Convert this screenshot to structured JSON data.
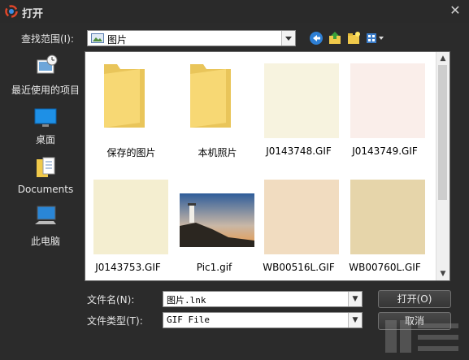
{
  "window": {
    "title": "打开"
  },
  "lookin": {
    "label": "查找范围(I):",
    "value": "图片"
  },
  "places": [
    {
      "label": "最近使用的项目",
      "icon": "recent-items-icon"
    },
    {
      "label": "桌面",
      "icon": "desktop-icon"
    },
    {
      "label": "Documents",
      "icon": "documents-icon"
    },
    {
      "label": "此电脑",
      "icon": "computer-icon"
    }
  ],
  "files": [
    {
      "name": "保存的图片",
      "kind": "folder"
    },
    {
      "name": "本机照片",
      "kind": "folder"
    },
    {
      "name": "J0143748.GIF",
      "kind": "image",
      "color": "#f7f3df"
    },
    {
      "name": "J0143749.GIF",
      "kind": "image",
      "color": "#faeeea"
    },
    {
      "name": "J0143753.GIF",
      "kind": "image",
      "color": "#f4eed0"
    },
    {
      "name": "Pic1.gif",
      "kind": "photo"
    },
    {
      "name": "WB00516L.GIF",
      "kind": "image",
      "color": "#f1dcc0"
    },
    {
      "name": "WB00760L.GIF",
      "kind": "image",
      "color": "#e6d5aa"
    }
  ],
  "filename": {
    "label": "文件名(N):",
    "value": "图片.lnk"
  },
  "filetype": {
    "label": "文件类型(T):",
    "value": "GIF File"
  },
  "buttons": {
    "open": "打开(O)",
    "cancel": "取消"
  },
  "colors": {
    "dialog_bg": "#2b2b2b",
    "list_bg": "#ffffff",
    "folder": "#f5d471"
  }
}
